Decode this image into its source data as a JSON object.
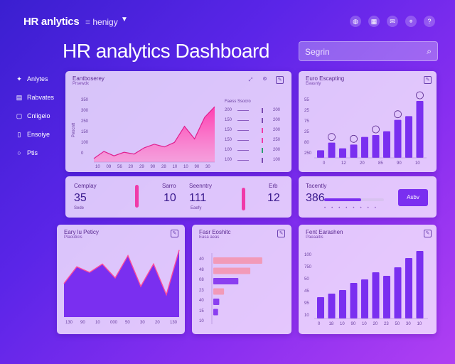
{
  "header": {
    "brand": "HR anlytics",
    "brand_sub": "= henigy",
    "title": "HR analytics Dashboard",
    "search_placeholder": "Segrin",
    "icons": [
      "globe-icon",
      "grid-icon",
      "mail-icon",
      "pin-icon",
      "help-icon"
    ]
  },
  "sidebar": {
    "items": [
      {
        "label": "Anlytes",
        "icon": "bird-icon"
      },
      {
        "label": "Rabvates",
        "icon": "chart-icon"
      },
      {
        "label": "Cnligeio",
        "icon": "doc-icon"
      },
      {
        "label": "Ensoiye",
        "icon": "file-icon"
      },
      {
        "label": "Ptis",
        "icon": "circle-icon"
      }
    ]
  },
  "card_area": {
    "title": "Eantboserey",
    "sub": "Prsewdx",
    "y_ticks": [
      "350",
      "300",
      "250",
      "150",
      "100",
      "0"
    ],
    "x_ticks": [
      "10",
      "09",
      "56",
      "20",
      "29",
      "90",
      "28",
      "10",
      "10",
      "90",
      "30"
    ],
    "y_axis_label": "Peocntt",
    "legend_rows": [
      "200",
      "150",
      "150",
      "150",
      "100",
      "100"
    ],
    "legend_values": [
      "200",
      "200",
      "200",
      "250",
      "200",
      "100"
    ],
    "legend_head": [
      "Faess",
      "Ssocro"
    ]
  },
  "card_bars_top": {
    "title": "Euro Escapting",
    "sub": "Eeasnly",
    "y_ticks": [
      "55",
      "25",
      "75",
      "25",
      "80",
      "250"
    ],
    "x_ticks": [
      "0",
      "12",
      "20",
      "85",
      "90",
      "10"
    ]
  },
  "kpi_row1": {
    "label_a": "Cemplay",
    "value_a": "35",
    "sub_a": "Sede",
    "label_b": "Sarro",
    "value_b": "10",
    "label_c": "Seenntry",
    "value_c": "111",
    "sub_c": "Eaefy",
    "label_d": "Erb",
    "value_d": "12"
  },
  "kpi_row2": {
    "label": "Tacently",
    "value": "386",
    "button_label": "Asbv"
  },
  "card_area2": {
    "title": "Eary lu Peticy",
    "sub": "Plaouticis",
    "x_ticks": [
      "130",
      "90",
      "10",
      "000",
      "50",
      "30",
      "20",
      "130"
    ]
  },
  "card_hbars": {
    "title": "Fasr Eoshitc",
    "sub": "Easa aeas",
    "y_ticks": [
      "40",
      "48",
      "08",
      "23",
      "40",
      "15",
      "10"
    ],
    "bars": [
      {
        "value": 0.82,
        "color": "#f29ab8"
      },
      {
        "value": 0.62,
        "color": "#f29ab8"
      },
      {
        "value": 0.42,
        "color": "#8a3ef0"
      },
      {
        "value": 0.18,
        "color": "#f29ab8"
      },
      {
        "value": 0.1,
        "color": "#8a3ef0"
      },
      {
        "value": 0.08,
        "color": "#8a3ef0"
      }
    ]
  },
  "card_bars_bottom": {
    "title": "Fent Earashen",
    "sub": "Paeaaitis",
    "y_ticks": [
      "100",
      "750",
      "50",
      "45",
      "95",
      "10"
    ],
    "x_ticks": [
      "0",
      "18",
      "10",
      "90",
      "10",
      "20",
      "23",
      "50",
      "30",
      "10"
    ]
  },
  "chart_data": [
    {
      "type": "area",
      "title": "Eantboserey",
      "ylabel": "Peocntt",
      "ylim": [
        0,
        350
      ],
      "x": [
        "10",
        "09",
        "56",
        "20",
        "29",
        "90",
        "28",
        "10",
        "10",
        "90",
        "30"
      ],
      "series": [
        {
          "values": [
            20,
            60,
            35,
            55,
            45,
            80,
            100,
            85,
            110,
            200,
            130,
            250,
            310
          ]
        }
      ]
    },
    {
      "type": "bar",
      "title": "Euro Escapting",
      "categories": [
        "0",
        "12",
        "20",
        "85",
        "90",
        "10"
      ],
      "values": [
        20,
        40,
        25,
        35,
        55,
        60,
        70,
        100,
        110,
        150
      ],
      "markers": [
        1,
        3,
        5,
        7,
        9
      ]
    },
    {
      "type": "area",
      "title": "Eary lu Peticy",
      "x": [
        "130",
        "90",
        "10",
        "000",
        "50",
        "30",
        "20",
        "130"
      ],
      "series": [
        {
          "values": [
            60,
            90,
            80,
            95,
            70,
            110,
            55,
            95,
            40,
            120
          ]
        }
      ]
    },
    {
      "type": "bar",
      "title": "Fent Earashen",
      "categories": [
        "0",
        "18",
        "10",
        "90",
        "10",
        "20",
        "23",
        "50",
        "30",
        "10"
      ],
      "values": [
        30,
        35,
        40,
        50,
        55,
        65,
        60,
        72,
        85,
        95
      ]
    }
  ],
  "colors": {
    "accent_pink": "#f03aa8",
    "accent_purple": "#7a2ff0",
    "card_bg": "#f6e8ff"
  }
}
